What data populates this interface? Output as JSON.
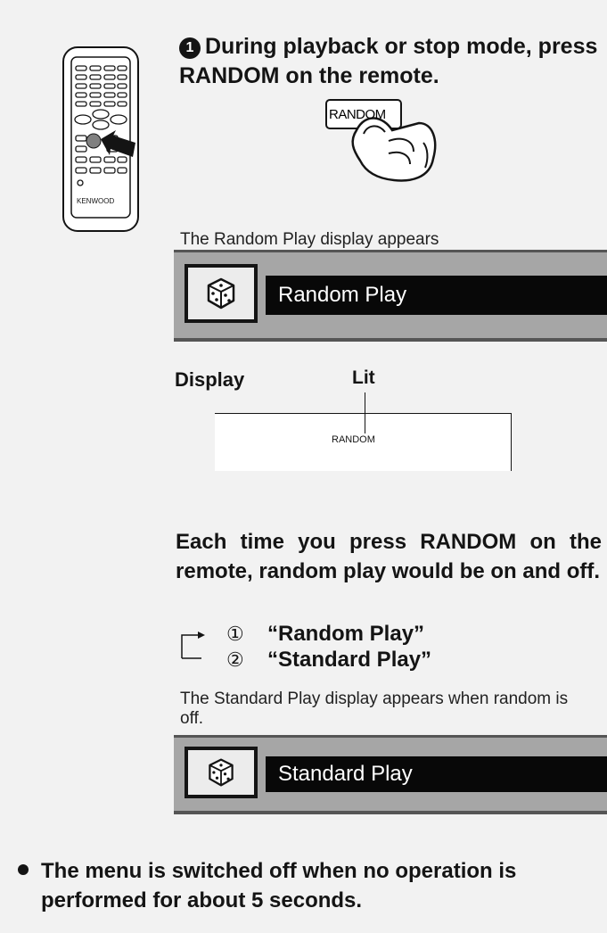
{
  "remote": {
    "brand": "KENWOOD"
  },
  "step1": {
    "number": "1",
    "text": "During playback or stop mode, press RANDOM on the remote."
  },
  "press_button": {
    "label": "RANDOM"
  },
  "random_display": {
    "caption": "The Random Play display appears",
    "text": "Random Play",
    "icon": "dice-icon"
  },
  "display_panel": {
    "label": "Display",
    "lit_label": "Lit",
    "indicator": "RANDOM"
  },
  "each_time_text": "Each time you press RANDOM on the remote, random play would be on and off.",
  "cycle": [
    {
      "num": "①",
      "label": "“Random Play”"
    },
    {
      "num": "②",
      "label": "“Standard Play”"
    }
  ],
  "standard_display": {
    "caption": "The Standard Play display appears when random is off.",
    "text": "Standard Play",
    "icon": "dice-icon"
  },
  "note": {
    "line1": "The menu is switched off when no operation is",
    "line2": "performed for about 5 seconds."
  },
  "colors": {
    "panel_bg": "#f2f2f2",
    "screen_gray": "#a6a6a6",
    "bar_black": "#080808"
  }
}
